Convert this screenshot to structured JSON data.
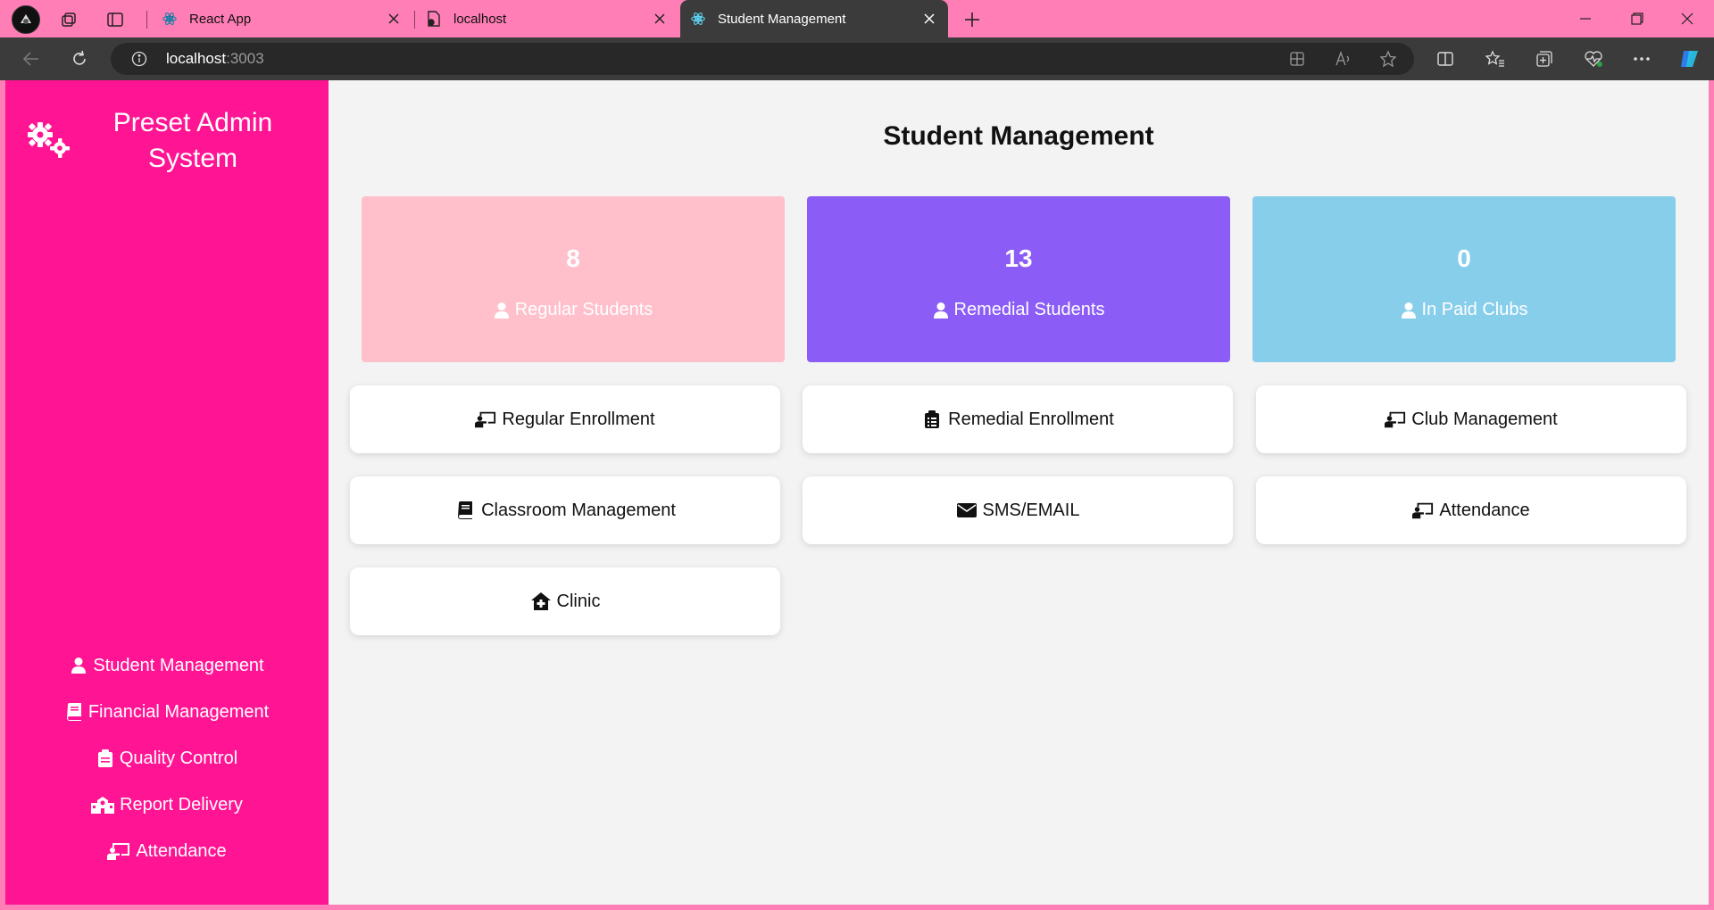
{
  "browser": {
    "tabs": [
      {
        "title": "React App",
        "favicon": "react-icon",
        "active": false
      },
      {
        "title": "localhost",
        "favicon": "file-icon",
        "active": false
      },
      {
        "title": "Student Management",
        "favicon": "react-icon",
        "active": true
      }
    ],
    "address": {
      "host": "localhost",
      "port": ":3003"
    }
  },
  "sidebar": {
    "title": "Preset Admin System",
    "brand_icon": "gears-icon",
    "items": [
      {
        "label": "Student Management",
        "icon": "user-icon"
      },
      {
        "label": "Financial Management",
        "icon": "book-icon"
      },
      {
        "label": "Quality Control",
        "icon": "clipboard-icon"
      },
      {
        "label": "Report Delivery",
        "icon": "school-icon"
      },
      {
        "label": "Attendance",
        "icon": "chalkboard-teacher-icon"
      }
    ]
  },
  "main": {
    "title": "Student Management",
    "stats": [
      {
        "value": "8",
        "label": "Regular Students",
        "color": "#ffc0cb",
        "icon": "user-icon"
      },
      {
        "value": "13",
        "label": "Remedial Students",
        "color": "#8b5cf6",
        "icon": "user-icon"
      },
      {
        "value": "0",
        "label": "In Paid Clubs",
        "color": "#87ceeb",
        "icon": "user-icon"
      }
    ],
    "cards": [
      {
        "label": "Regular Enrollment",
        "icon": "chalkboard-teacher-icon"
      },
      {
        "label": "Remedial Enrollment",
        "icon": "clipboard-list-icon"
      },
      {
        "label": "Club Management",
        "icon": "chalkboard-teacher-icon"
      },
      {
        "label": "Classroom Management",
        "icon": "book-icon"
      },
      {
        "label": "SMS/EMAIL",
        "icon": "envelope-icon"
      },
      {
        "label": "Attendance",
        "icon": "chalkboard-teacher-icon"
      },
      {
        "label": "Clinic",
        "icon": "house-medical-icon"
      }
    ]
  },
  "colors": {
    "tab_strip": "#ff7eb6",
    "sidebar": "#ff1493",
    "page_bg": "#f3f3f3"
  }
}
